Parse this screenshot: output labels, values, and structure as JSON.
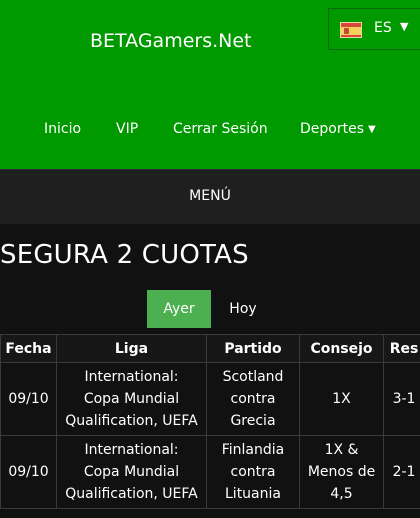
{
  "header": {
    "brand": "BETAGamers.Net",
    "language": {
      "code": "ES",
      "icon": "spain-flag-icon"
    },
    "nav": [
      {
        "label": "Inicio"
      },
      {
        "label": "VIP"
      },
      {
        "label": "Cerrar Sesión"
      },
      {
        "label": "Deportes",
        "icon": "caret-down-icon"
      }
    ]
  },
  "menu": {
    "label": "MENÚ"
  },
  "main": {
    "title": "SEGURA 2 CUOTAS",
    "tabs": [
      {
        "label": "Ayer",
        "active": true
      },
      {
        "label": "Hoy",
        "active": false
      }
    ],
    "table": {
      "headers": [
        "Fecha",
        "Liga",
        "Partido",
        "Consejo",
        "Res"
      ],
      "rows": [
        {
          "fecha": "09/10",
          "liga": "International:\nCopa Mundial\nQualification, UEFA",
          "partido": "Scotland\ncontra\nGrecia",
          "consejo": "1X",
          "res": "3-1"
        },
        {
          "fecha": "09/10",
          "liga": "International:\nCopa Mundial\nQualification, UEFA",
          "partido": "Finlandia\ncontra\nLituania",
          "consejo": "1X &\nMenos de\n4,5",
          "res": "2-1"
        }
      ]
    }
  },
  "colors": {
    "header_bg": "#009900",
    "active_tab": "#4caf50",
    "page_bg": "#111111",
    "menubar_bg": "#1f1f1f"
  }
}
